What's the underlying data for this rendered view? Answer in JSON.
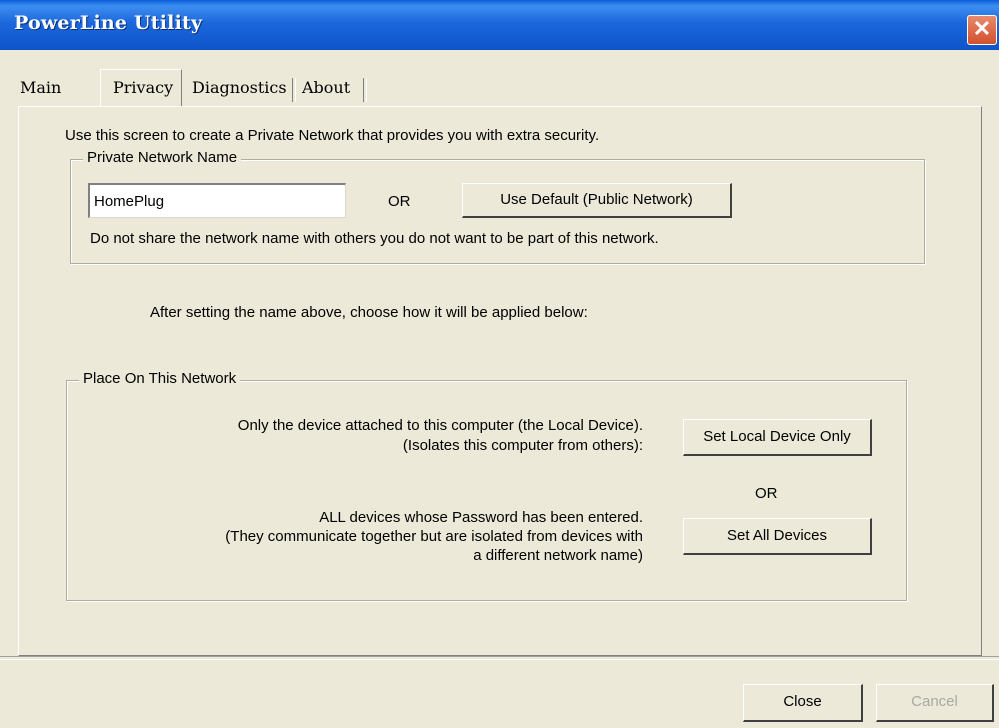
{
  "window": {
    "title": "PowerLine Utility",
    "close_glyph": "✕"
  },
  "tabs": [
    {
      "label": "Main"
    },
    {
      "label": "Privacy"
    },
    {
      "label": "Diagnostics"
    },
    {
      "label": "About"
    }
  ],
  "privacy": {
    "intro": "Use this screen to create a Private Network that provides you with extra security.",
    "network_group": {
      "legend": "Private Network Name",
      "name_value": "HomePlug",
      "or_label": "OR",
      "default_button": "Use Default (Public Network)",
      "warning": "Do not share the network name with others you do not want to be part of this network."
    },
    "after_setting": "After setting the name above, choose how it will be applied below:",
    "place_group": {
      "legend": "Place On This Network",
      "local_line1": "Only the device attached to this computer (the Local Device).",
      "local_line2": "(Isolates this computer from others):",
      "local_button": "Set Local Device Only",
      "or_label": "OR",
      "all_line1": "ALL devices whose Password has been entered.",
      "all_line2": "(They communicate together but are isolated from devices with",
      "all_line3": "a different network name)",
      "all_button": "Set All Devices"
    }
  },
  "footer": {
    "close_button": "Close",
    "cancel_button": "Cancel"
  },
  "colors": {
    "title_bar": "#1c67dd",
    "window_bg": "#ece9d8",
    "close_box": "#d2512d"
  }
}
